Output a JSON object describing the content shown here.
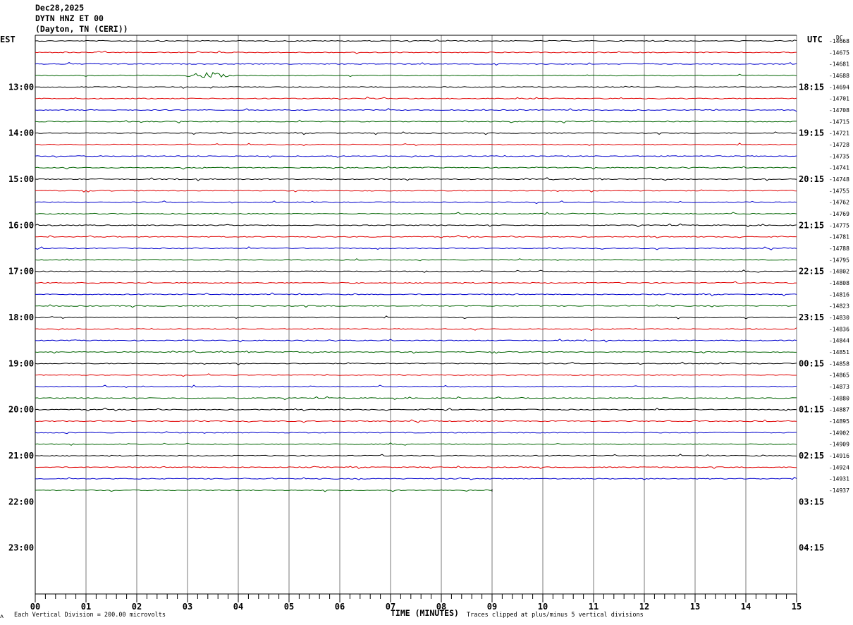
{
  "header": {
    "date": "Dec28,2025",
    "station": "DYTN HNZ ET 00",
    "location": "(Dayton, TN (CERI))"
  },
  "left_zone": "EST",
  "right_zone": "UTC",
  "dc_label": "DC",
  "chart_data": {
    "type": "line",
    "title": "",
    "xlabel": "TIME (MINUTES)",
    "xlim": [
      0,
      15
    ],
    "x_ticks": [
      "00",
      "01",
      "02",
      "03",
      "04",
      "05",
      "06",
      "07",
      "08",
      "09",
      "10",
      "11",
      "12",
      "13",
      "14",
      "15"
    ],
    "rows_total": 48,
    "row_minutes": 15,
    "hour_labels_est": [
      "13:00",
      "14:00",
      "15:00",
      "16:00",
      "17:00",
      "18:00",
      "19:00",
      "20:00",
      "21:00",
      "22:00",
      "23:00"
    ],
    "hour_labels_utc": [
      "18:15",
      "19:15",
      "20:15",
      "21:15",
      "22:15",
      "23:15",
      "00:15",
      "01:15",
      "02:15",
      "03:15",
      "04:15"
    ],
    "dc_offsets": [
      -14668,
      -14675,
      -14681,
      -14688,
      -14694,
      -14701,
      -14708,
      -14715,
      -14721,
      -14728,
      -14735,
      -14741,
      -14748,
      -14755,
      -14762,
      -14769,
      -14775,
      -14781,
      -14788,
      -14795,
      -14802,
      -14808,
      -14816,
      -14823,
      -14830,
      -14836,
      -14844,
      -14851,
      -14858,
      -14865,
      -14873,
      -14880,
      -14887,
      -14895,
      -14902,
      -14909,
      -14916,
      -14924,
      -14931,
      -14937
    ],
    "trace_colors": [
      "#000000",
      "#e00000",
      "#0000cc",
      "#006400"
    ],
    "last_trace_end_minute": 9,
    "event": {
      "row": 3,
      "start_minute": 2.9,
      "end_minute": 3.9
    }
  },
  "footer": {
    "scale": "Each Vertical Division =  200.00 microvolts",
    "clip": "Traces clipped at plus/minus 5 vertical divisions"
  }
}
